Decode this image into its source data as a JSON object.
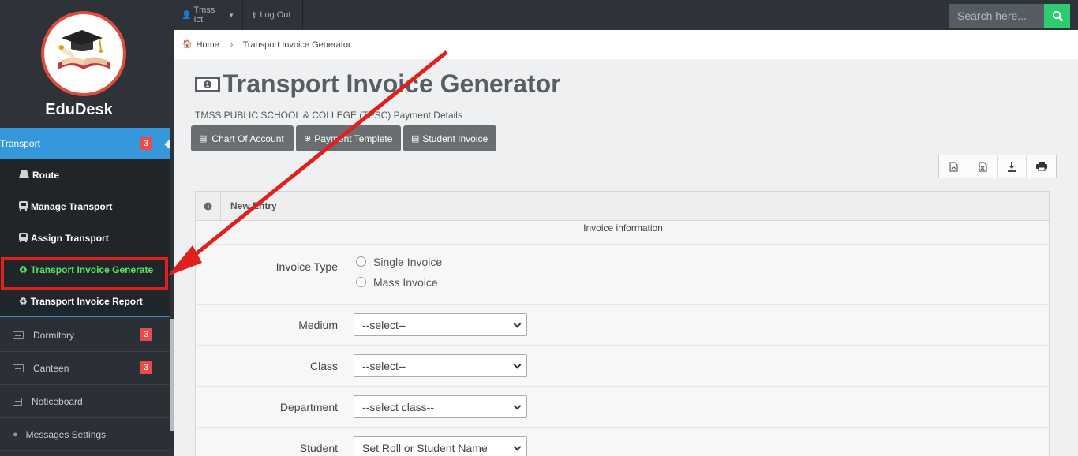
{
  "sidebar": {
    "brand": "EduDesk",
    "menu": [
      {
        "label": "Transport",
        "badge": "3",
        "icon": "id-card-icon"
      },
      {
        "label": "Dormitory",
        "badge": "3",
        "icon": "id-card-icon"
      },
      {
        "label": "Canteen",
        "badge": "3",
        "icon": "id-card-icon"
      },
      {
        "label": "Noticeboard",
        "icon": "window-icon"
      },
      {
        "label": "Messages Settings",
        "icon": "chat-icon"
      }
    ],
    "submenu": [
      {
        "label": "Route",
        "icon": "road-icon"
      },
      {
        "label": "Manage Transport",
        "icon": "bus-icon"
      },
      {
        "label": "Assign Transport",
        "icon": "bus-icon"
      },
      {
        "label": "Transport Invoice Generate",
        "icon": "recycle-icon"
      },
      {
        "label": "Transport Invoice Report",
        "icon": "recycle-icon"
      }
    ]
  },
  "topbar": {
    "user": "Tmss Ict",
    "logout": "Log Out",
    "search_placeholder": "Search here..."
  },
  "breadcrumb": {
    "home": "Home",
    "current": "Transport Invoice Generator"
  },
  "main": {
    "title": "Transport Invoice Generator",
    "subtitle": "TMSS PUBLIC SCHOOL & COLLEGE (TPSC) Payment Details",
    "buttons": [
      "Chart Of Account",
      "Payment Templete",
      "Student Invoice"
    ],
    "panel_title": "New Entry",
    "section_label": "Invoice information",
    "form": {
      "invoice_type_label": "Invoice Type",
      "invoice_type_options": [
        "Single Invoice",
        "Mass Invoice"
      ],
      "medium_label": "Medium",
      "medium_value": "--select--",
      "class_label": "Class",
      "class_value": "--select--",
      "department_label": "Department",
      "department_value": "--select class--",
      "student_label": "Student",
      "student_value": "Set Roll or Student Name"
    }
  },
  "colors": {
    "sidebar_bg": "#2d3339",
    "active_bg": "#3498db",
    "badge": "#e94b4b",
    "highlight_text": "#5fe05f",
    "annotation_red": "#e0201c",
    "search_button": "#2ecc71"
  }
}
